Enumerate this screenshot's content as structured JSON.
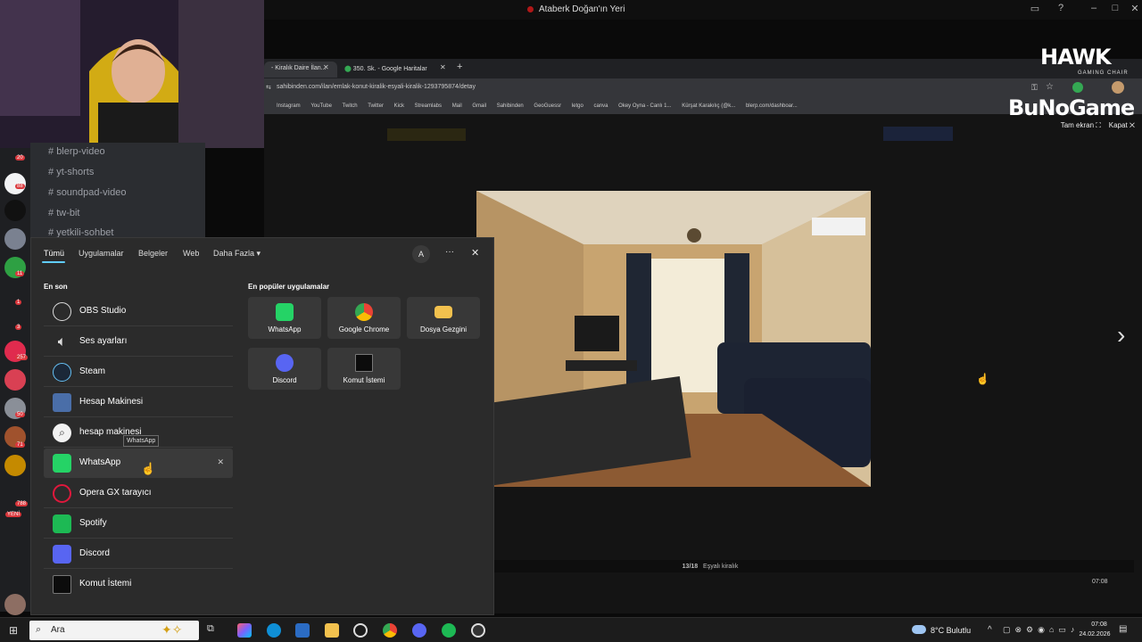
{
  "window": {
    "title": "Ataberk Doğan'ın Yeri"
  },
  "browser": {
    "tabs": [
      {
        "label": "- Kiralık Daire İlan..."
      },
      {
        "label": "350. Sk. - Google Haritalar"
      }
    ],
    "new_tab": "+",
    "url": "sahibinden.com/ilan/emlak-konut-kiralik-esyali-kiralik-1293795874/detay",
    "bookmarks": [
      "Instagram",
      "YouTube",
      "Twitch",
      "Twitter",
      "Kick",
      "Streamlabs",
      "Mail",
      "Gmail",
      "Sahibinden",
      "GeoGuessr",
      "letgo",
      "canva",
      "Okey Oyna - Canlı 1...",
      "Kürşat Karakılıç (@k...",
      "blerp.com/dashboar..."
    ],
    "viewer": {
      "fullscreen_label": "Tam ekran",
      "close_label": "Kapat",
      "counter": "13/18",
      "caption": "Eşyalı kiralık"
    }
  },
  "discord": {
    "channels": [
      "blerp-video",
      "yt-shorts",
      "soundpad-video",
      "tw-bit",
      "yetkili-sohbet"
    ],
    "badges": [
      "20",
      "88",
      "11",
      "1",
      "3",
      "257",
      "50",
      "71",
      "788",
      "YENİ"
    ]
  },
  "start_menu": {
    "tabs": [
      "Tümü",
      "Uygulamalar",
      "Belgeler",
      "Web",
      "Daha Fazla"
    ],
    "avatar": "A",
    "more": "···",
    "close": "✕",
    "recent_title": "En son",
    "recent": [
      {
        "label": "OBS Studio"
      },
      {
        "label": "Ses ayarları"
      },
      {
        "label": "Steam"
      },
      {
        "label": "Hesap Makinesi"
      },
      {
        "label": "hesap makinesi"
      },
      {
        "label": "WhatsApp"
      },
      {
        "label": "Opera GX tarayıcı"
      },
      {
        "label": "Spotify"
      },
      {
        "label": "Discord"
      },
      {
        "label": "Komut İstemi"
      }
    ],
    "popular_title": "En popüler uygulamalar",
    "popular": [
      {
        "label": "WhatsApp"
      },
      {
        "label": "Google Chrome"
      },
      {
        "label": "Dosya Gezgini"
      },
      {
        "label": "Discord"
      },
      {
        "label": "Komut İstemi"
      }
    ],
    "tooltip": "WhatsApp",
    "remove": "✕"
  },
  "taskbar": {
    "search_placeholder": "Ara",
    "weather": "8°C Bulutlu",
    "time": "07:08",
    "date": "24.02.2026",
    "viewer_time": "07:08"
  },
  "overlays": {
    "brand1": "HAWK",
    "brand1_sub": "GAMING CHAIR",
    "brand2": "BuNoGame"
  },
  "colors": {
    "accent": "#60cdff",
    "whatsapp": "#25d366",
    "discord": "#5865f2",
    "spotify": "#1db954"
  }
}
